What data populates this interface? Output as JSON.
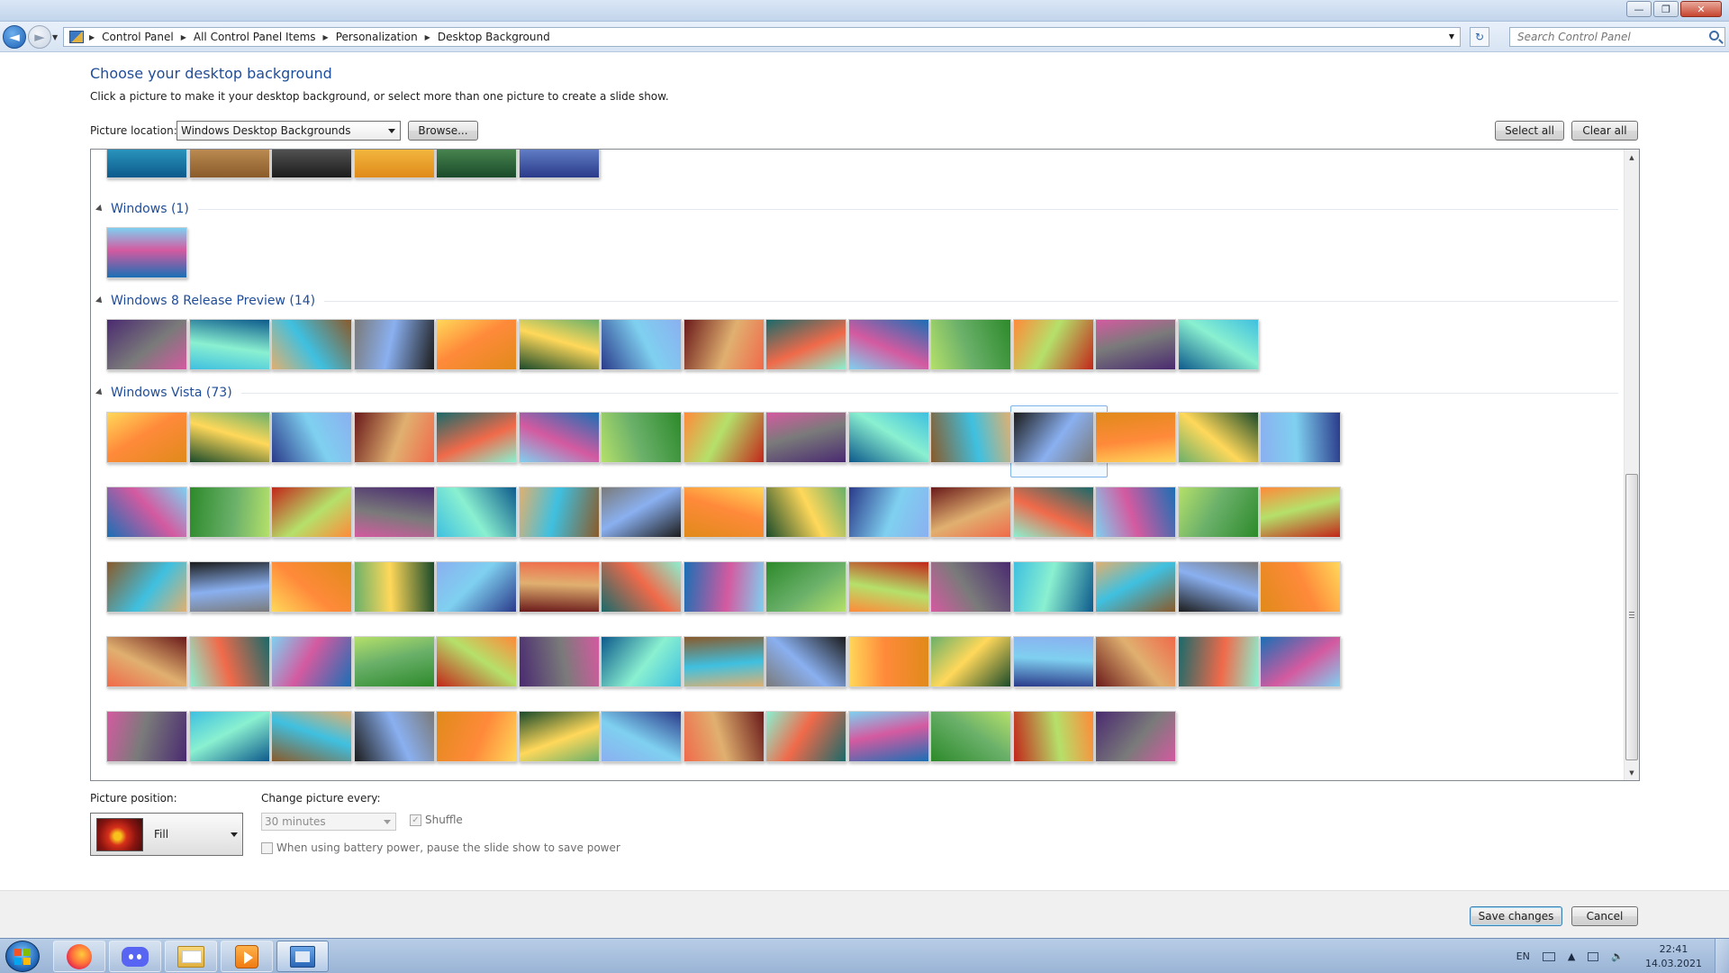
{
  "window": {
    "controls": {
      "minimize": "—",
      "maximize": "❐",
      "close": "✕"
    }
  },
  "address": {
    "breadcrumbs": [
      "Control Panel",
      "All Control Panel Items",
      "Personalization",
      "Desktop Background"
    ],
    "search_placeholder": "Search Control Panel",
    "back_icon": "back-arrow-icon",
    "forward_icon": "forward-arrow-icon",
    "refresh_icon": "refresh-icon",
    "refresh_glyph": "↻"
  },
  "main": {
    "title": "Choose your desktop background",
    "description": "Click a picture to make it your desktop background, or select more than one picture to create a slide show.",
    "picture_location_label": "Picture location:",
    "picture_location_value": "Windows Desktop Backgrounds",
    "browse_label": "Browse...",
    "select_all_label": "Select all",
    "clear_all_label": "Clear all"
  },
  "gallery": {
    "partial_row_count": 6,
    "groups": [
      {
        "name": "Windows (1)",
        "count": 1
      },
      {
        "name": "Windows 8 Release Preview (14)",
        "count": 14
      },
      {
        "name": "Windows Vista (73)",
        "visible_count": 73
      }
    ],
    "selected_thumbnail": "Windows Vista row 1, item 10"
  },
  "settings": {
    "picture_position_label": "Picture position:",
    "picture_position_value": "Fill",
    "change_every_label": "Change picture every:",
    "change_every_value": "30 minutes",
    "shuffle_label": "Shuffle",
    "shuffle_checked": true,
    "battery_label": "When using battery power, pause the slide show to save power",
    "battery_checked": false
  },
  "footer": {
    "save_label": "Save changes",
    "cancel_label": "Cancel"
  },
  "taskbar": {
    "apps": [
      "firefox",
      "discord",
      "windows-explorer",
      "media-player",
      "control-panel"
    ],
    "language": "EN",
    "time": "22:41",
    "date": "14.03.2021"
  },
  "colors": {
    "title_blue": "#1f4d99",
    "group_blue": "#1f4d99",
    "taskbar": "#9ab4d6"
  }
}
